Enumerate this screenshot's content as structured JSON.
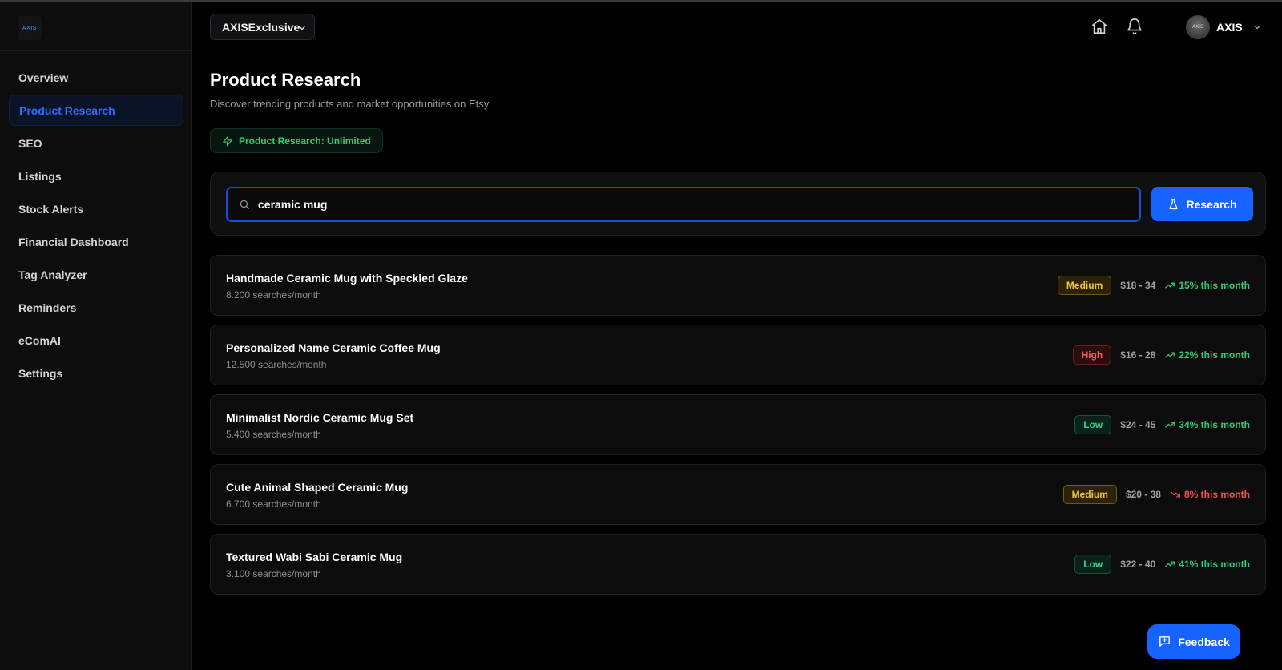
{
  "app": {
    "logo_text": "AXIS"
  },
  "header": {
    "store_selector": "AXISExclusive",
    "home_icon": "home-icon",
    "notification_icon": "bell-icon",
    "user": {
      "name": "AXIS",
      "avatar_text": "AXIS"
    }
  },
  "sidebar": {
    "items": [
      {
        "label": "Overview",
        "active": false
      },
      {
        "label": "Product Research",
        "active": true
      },
      {
        "label": "SEO",
        "active": false
      },
      {
        "label": "Listings",
        "active": false
      },
      {
        "label": "Stock Alerts",
        "active": false
      },
      {
        "label": "Financial Dashboard",
        "active": false
      },
      {
        "label": "Tag Analyzer",
        "active": false
      },
      {
        "label": "Reminders",
        "active": false
      },
      {
        "label": "eComAI",
        "active": false
      },
      {
        "label": "Settings",
        "active": false
      }
    ]
  },
  "main": {
    "title": "Product Research",
    "subtitle": "Discover trending products and market opportunities on Etsy.",
    "quota_badge": "Product Research: Unlimited",
    "search": {
      "value": "ceramic mug",
      "placeholder": ""
    },
    "research_button": "Research",
    "results": [
      {
        "name": "Handmade Ceramic Mug with Speckled Glaze",
        "searches": "8.200 searches/month",
        "competition": "Medium",
        "price": "$18 - 34",
        "trend": "15% this month",
        "trend_dir": "up"
      },
      {
        "name": "Personalized Name Ceramic Coffee Mug",
        "searches": "12.500 searches/month",
        "competition": "High",
        "price": "$16 - 28",
        "trend": "22% this month",
        "trend_dir": "up"
      },
      {
        "name": "Minimalist Nordic Ceramic Mug Set",
        "searches": "5.400 searches/month",
        "competition": "Low",
        "price": "$24 - 45",
        "trend": "34% this month",
        "trend_dir": "up"
      },
      {
        "name": "Cute Animal Shaped Ceramic Mug",
        "searches": "6.700 searches/month",
        "competition": "Medium",
        "price": "$20 - 38",
        "trend": "8% this month",
        "trend_dir": "down"
      },
      {
        "name": "Textured Wabi Sabi Ceramic Mug",
        "searches": "3.100 searches/month",
        "competition": "Low",
        "price": "$22 - 40",
        "trend": "41% this month",
        "trend_dir": "up"
      }
    ]
  },
  "feedback_button": "Feedback",
  "colors": {
    "accent": "#1663ff",
    "active_nav_text": "#2f6bff",
    "success": "#2fcc74",
    "danger": "#f05252",
    "warning": "#f2c640"
  }
}
